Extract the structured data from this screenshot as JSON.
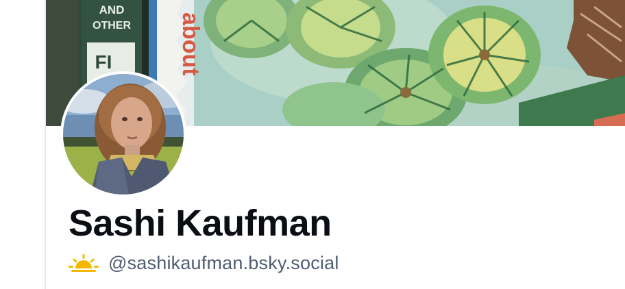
{
  "profile": {
    "display_name": "Sashi Kaufman",
    "handle": "@sashikaufman.bsky.social",
    "handle_prefix_icon": "sunrise-icon"
  },
  "banner": {
    "book_spine_text_1": "AND",
    "book_spine_text_2": "OTHER",
    "book_spine_text_3": "FI",
    "book_spine_text_4": "about"
  },
  "colors": {
    "name_text": "#0b0f14",
    "handle_text": "#4e5d70",
    "icon_yellow": "#f5b800",
    "divider": "#e3e8ee"
  }
}
